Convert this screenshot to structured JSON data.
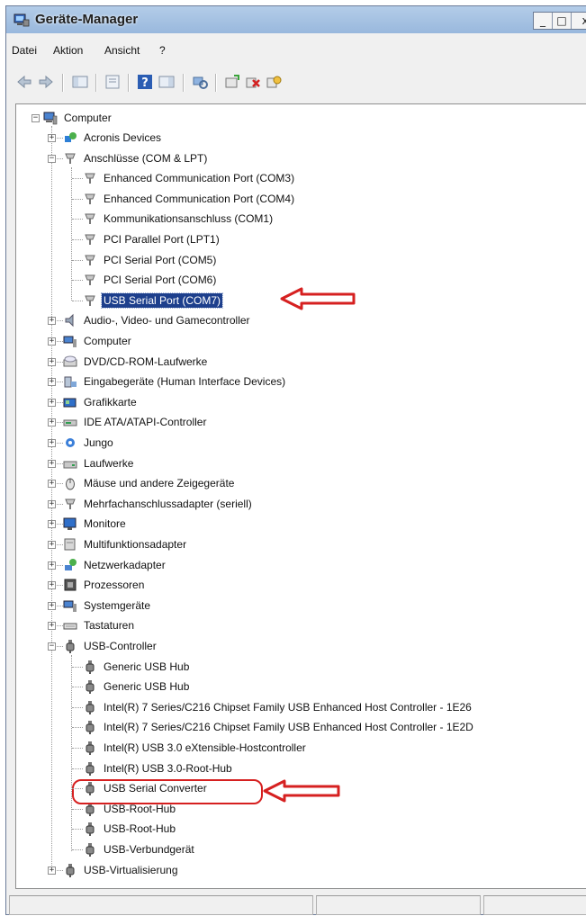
{
  "window": {
    "title": "Geräte-Manager",
    "buttons": {
      "minimize": "_",
      "maximize": "□",
      "close": "x"
    }
  },
  "menubar": {
    "items": [
      {
        "label": "Datei"
      },
      {
        "label": "Aktion"
      },
      {
        "label": "Ansicht"
      },
      {
        "label": "?"
      }
    ]
  },
  "toolbar": {
    "icons": [
      "back-icon",
      "forward-icon",
      "show-hide-tree-icon",
      "properties-icon",
      "help-icon",
      "action-view-icon",
      "scan-hardware-icon",
      "update-driver-icon",
      "uninstall-icon",
      "disable-icon"
    ]
  },
  "tree": {
    "root": "Computer",
    "nodes": [
      {
        "label": "Acronis Devices"
      },
      {
        "label": "Anschlüsse (COM & LPT)",
        "children": [
          {
            "label": "Enhanced Communication Port (COM3)"
          },
          {
            "label": "Enhanced Communication Port (COM4)"
          },
          {
            "label": "Kommunikationsanschluss (COM1)"
          },
          {
            "label": "PCI Parallel Port (LPT1)"
          },
          {
            "label": "PCI Serial Port (COM5)"
          },
          {
            "label": "PCI Serial Port (COM6)"
          },
          {
            "label": "USB Serial Port (COM7)"
          }
        ]
      },
      {
        "label": "Audio-, Video- und Gamecontroller"
      },
      {
        "label": "Computer"
      },
      {
        "label": "DVD/CD-ROM-Laufwerke"
      },
      {
        "label": "Eingabegeräte (Human Interface Devices)"
      },
      {
        "label": "Grafikkarte"
      },
      {
        "label": "IDE ATA/ATAPI-Controller"
      },
      {
        "label": "Jungo"
      },
      {
        "label": "Laufwerke"
      },
      {
        "label": "Mäuse und andere Zeigegeräte"
      },
      {
        "label": "Mehrfachanschlussadapter (seriell)"
      },
      {
        "label": "Monitore"
      },
      {
        "label": "Multifunktionsadapter"
      },
      {
        "label": "Netzwerkadapter"
      },
      {
        "label": "Prozessoren"
      },
      {
        "label": "Systemgeräte"
      },
      {
        "label": "Tastaturen"
      },
      {
        "label": "USB-Controller",
        "children": [
          {
            "label": "Generic USB Hub"
          },
          {
            "label": "Generic USB Hub"
          },
          {
            "label": "Intel(R) 7 Series/C216 Chipset Family USB Enhanced Host Controller - 1E26"
          },
          {
            "label": "Intel(R) 7 Series/C216 Chipset Family USB Enhanced Host Controller - 1E2D"
          },
          {
            "label": "Intel(R) USB 3.0 eXtensible-Hostcontroller"
          },
          {
            "label": "Intel(R) USB 3.0-Root-Hub"
          },
          {
            "label": "USB Serial Converter"
          },
          {
            "label": "USB-Root-Hub"
          },
          {
            "label": "USB-Root-Hub"
          },
          {
            "label": "USB-Verbundgerät"
          }
        ]
      },
      {
        "label": "USB-Virtualisierung"
      }
    ]
  },
  "colors": {
    "selection": "#1d3f8c",
    "annotation": "#d62020",
    "titlebar": "#a9c4e5"
  }
}
